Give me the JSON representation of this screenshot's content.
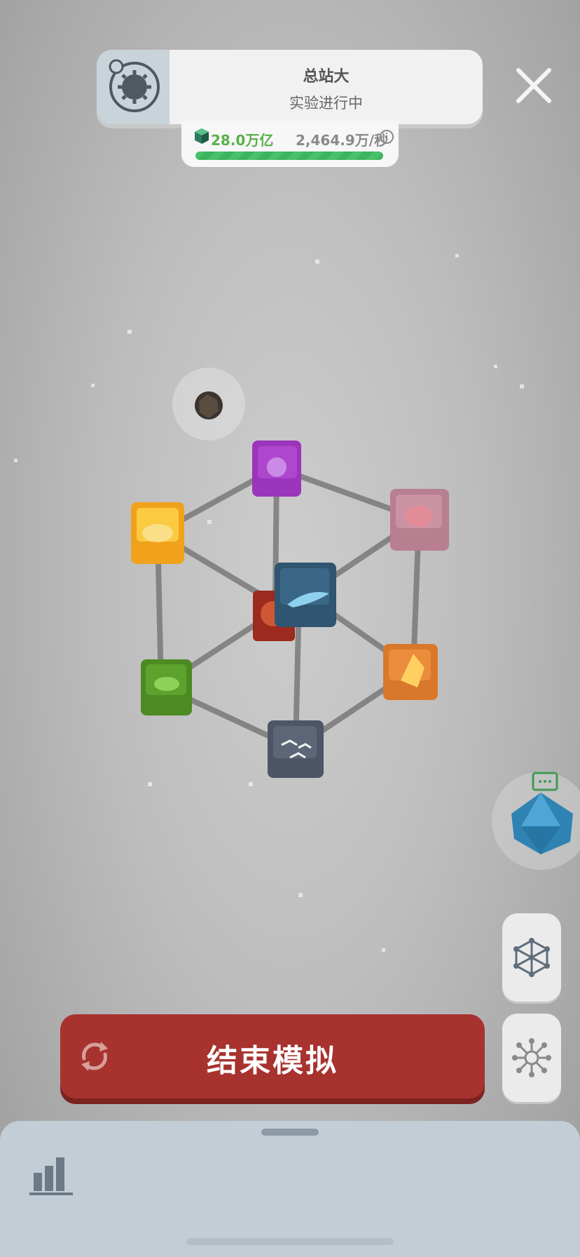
{
  "header": {
    "title": "总站大",
    "subtitle": "实验进行中",
    "icon": "gear-planet-icon"
  },
  "close": {
    "icon": "close-icon"
  },
  "resources": {
    "amount": "28.0万亿",
    "rate": "2,464.9万/秒",
    "progress": 1.0,
    "gem_icon": "cube-gem-icon",
    "info_icon": "info-icon"
  },
  "graph": {
    "nodes": [
      {
        "name": "jellyfish",
        "color": "#8a2aa8"
      },
      {
        "name": "trex-skull",
        "color": "#f5b21e"
      },
      {
        "name": "brain",
        "color": "#b7818f"
      },
      {
        "name": "whale",
        "color": "#2f5570"
      },
      {
        "name": "planet-core",
        "color": "#9c2a1e"
      },
      {
        "name": "frog",
        "color": "#4c8a23"
      },
      {
        "name": "lion",
        "color": "#d9772a"
      },
      {
        "name": "birds",
        "color": "#4e5566"
      }
    ]
  },
  "end_button": {
    "label": "结束模拟",
    "icon": "cycle-arrows-icon",
    "color": "#a7322e"
  },
  "side_buttons": [
    {
      "icon": "network-graph-icon"
    },
    {
      "icon": "neuron-icon"
    }
  ],
  "bottom_panel": {
    "icon": "bar-chart-icon"
  }
}
